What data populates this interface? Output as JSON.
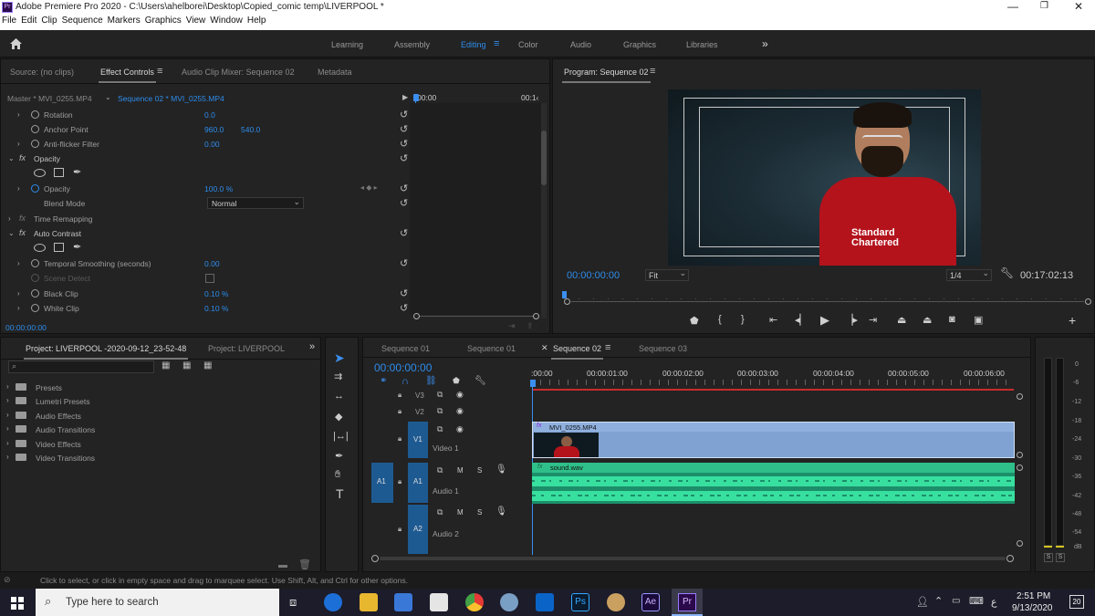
{
  "window": {
    "title": "Adobe Premiere Pro 2020 - C:\\Users\\ahelborei\\Desktop\\Copied_comic temp\\LIVERPOOL *",
    "app_icon": "Pr"
  },
  "menu": [
    "File",
    "Edit",
    "Clip",
    "Sequence",
    "Markers",
    "Graphics",
    "View",
    "Window",
    "Help"
  ],
  "workspaces": {
    "items": [
      "Learning",
      "Assembly",
      "Editing",
      "Color",
      "Audio",
      "Graphics",
      "Libraries"
    ],
    "active": "Editing",
    "more": "»"
  },
  "effect_panel": {
    "tabs": [
      "Source: (no clips)",
      "Effect Controls",
      "Audio Clip Mixer: Sequence 02",
      "Metadata"
    ],
    "master": "Master * MVI_0255.MP4",
    "sequence": "Sequence 02 * MVI_0255.MP4",
    "ruler_start": "00:00",
    "ruler_end": "00:1‹",
    "rows": [
      {
        "label": "Rotation",
        "v1": "0.0",
        "v2": ""
      },
      {
        "label": "Anchor Point",
        "v1": "960.0",
        "v2": "540.0"
      },
      {
        "label": "Anti-flicker Filter",
        "v1": "0.00",
        "v2": ""
      },
      {
        "label": "Opacity",
        "v1": "",
        "v2": ""
      },
      {
        "label": "Opacity",
        "v1": "100.0 %",
        "v2": ""
      },
      {
        "label": "Blend Mode",
        "v1": "Normal",
        "v2": ""
      },
      {
        "label": "Time Remapping",
        "v1": "",
        "v2": ""
      },
      {
        "label": "Auto Contrast",
        "v1": "",
        "v2": ""
      },
      {
        "label": "Temporal Smoothing (seconds)",
        "v1": "0.00",
        "v2": ""
      },
      {
        "label": "Scene Detect",
        "v1": "",
        "v2": ""
      },
      {
        "label": "Black Clip",
        "v1": "0.10 %",
        "v2": ""
      },
      {
        "label": "White Clip",
        "v1": "0.10 %",
        "v2": ""
      }
    ],
    "timecode": "00:00:00:00"
  },
  "program": {
    "title": "Program: Sequence 02",
    "timecode": "00:00:00:00",
    "fit": "Fit",
    "quality": "1/4",
    "duration": "00:17:02:13"
  },
  "project": {
    "tabs": [
      "Project: LIVERPOOL -2020-09-12_23-52-48",
      "Project: LIVERPOOL"
    ],
    "items": [
      "Presets",
      "Lumetri Presets",
      "Audio Effects",
      "Audio Transitions",
      "Video Effects",
      "Video Transitions"
    ]
  },
  "timeline": {
    "tabs": [
      "Sequence 01",
      "Sequence 01",
      "Sequence 02",
      "Sequence 03"
    ],
    "active": "Sequence 02",
    "timecode": "00:00:00:00",
    "ruler": [
      ":00:00",
      "00:00:01:00",
      "00:00:02:00",
      "00:00:03:00",
      "00:00:04:00",
      "00:00:05:00",
      "00:00:06:00"
    ],
    "tracks": {
      "v3": "V3",
      "v2": "V2",
      "v1": "V1",
      "video1": "Video 1",
      "a1": "A1",
      "audio1": "Audio 1",
      "a2": "A2",
      "audio2": "Audio 2",
      "m": "M",
      "s": "S"
    },
    "video_clip": "MVI_0255.MP4",
    "audio_clip": "sound.wav"
  },
  "meter": {
    "levels": [
      "0",
      "-6",
      "-12",
      "-18",
      "-24",
      "-30",
      "-36",
      "-42",
      "-48",
      "-54",
      "dB"
    ],
    "solo": [
      "S",
      "S"
    ]
  },
  "status": "Click to select, or click in empty space and drag to marquee select. Use Shift, Alt, and Ctrl for other options.",
  "taskbar": {
    "search": "Type here to search",
    "time": "2:51 PM",
    "date": "9/13/2020",
    "lang": "ع",
    "notif": "20"
  },
  "colors": {
    "accent": "#2d8ceb",
    "audio": "#2fbf8a",
    "video": "#8fb0de",
    "playhead": "#3b8ff0"
  }
}
